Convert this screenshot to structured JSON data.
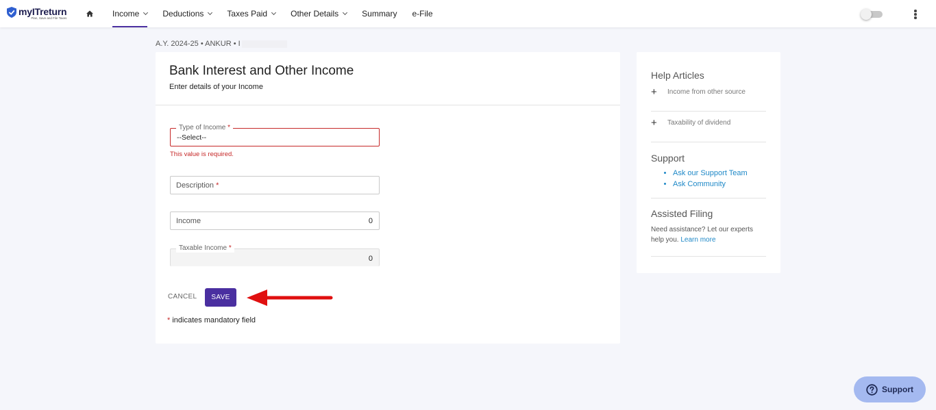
{
  "brand": {
    "name": "myITreturn",
    "tagline": "Plan, Save and File Taxes"
  },
  "nav": {
    "items": [
      {
        "label": "Income",
        "dropdown": true,
        "active": true
      },
      {
        "label": "Deductions",
        "dropdown": true,
        "active": false
      },
      {
        "label": "Taxes Paid",
        "dropdown": true,
        "active": false
      },
      {
        "label": "Other Details",
        "dropdown": true,
        "active": false
      },
      {
        "label": "Summary",
        "dropdown": false,
        "active": false
      },
      {
        "label": "e-File",
        "dropdown": false,
        "active": false
      }
    ]
  },
  "breadcrumb": "A.Y. 2024-25 • ANKUR • I",
  "form": {
    "title": "Bank Interest and Other Income",
    "subtitle": "Enter details of your Income",
    "type_of_income": {
      "label": "Type of Income",
      "value": "--Select--",
      "error": "This value is required."
    },
    "description": {
      "placeholder": "Description"
    },
    "income": {
      "placeholder": "Income",
      "value": "0"
    },
    "taxable_income": {
      "label": "Taxable Income",
      "value": "0"
    },
    "required_mark": "*",
    "cancel_label": "CANCEL",
    "save_label": "SAVE",
    "mandatory_note": "indicates mandatory field"
  },
  "sidebar": {
    "help_heading": "Help Articles",
    "help_items": [
      "Income from other source",
      "Taxability of dividend"
    ],
    "support_heading": "Support",
    "support_links": [
      "Ask our Support Team",
      "Ask Community"
    ],
    "assisted_heading": "Assisted Filing",
    "assisted_text": "Need assistance? Let our experts help you.",
    "assisted_link": "Learn more"
  },
  "support_button": "Support",
  "colors": {
    "accent": "#4a2fa0",
    "error": "#c62828",
    "link": "#1e88c7",
    "annotation_arrow": "#e01010"
  }
}
